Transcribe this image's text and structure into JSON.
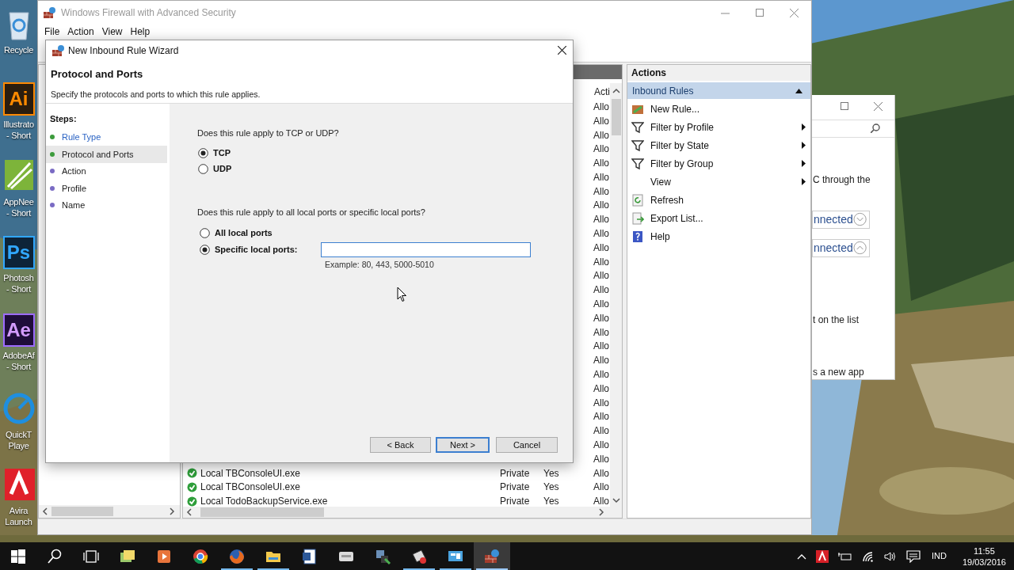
{
  "desktop_icons": [
    {
      "label": "Recycle",
      "kind": "recycle"
    },
    {
      "label": "Illustrato\n- Short",
      "kind": "ai",
      "glyph": "Ai"
    },
    {
      "label": "AppNee\n- Short",
      "kind": "appnee"
    },
    {
      "label": "Photosh\n- Short",
      "kind": "ps",
      "glyph": "Ps"
    },
    {
      "label": "AdobeAf\n- Short",
      "kind": "ae",
      "glyph": "Ae"
    },
    {
      "label": "QuickT\nPlaye",
      "kind": "quicktime"
    },
    {
      "label": "Avira\nLaunch",
      "kind": "avira"
    }
  ],
  "back_window": {
    "items": [
      {
        "kind": "text",
        "text": "C through the"
      },
      {
        "kind": "section",
        "text": "nnected",
        "expanded": false
      },
      {
        "kind": "section",
        "text": "nnected",
        "expanded": true
      },
      {
        "kind": "text",
        "text": "t on the list"
      },
      {
        "kind": "text",
        "text": "s a new app"
      }
    ]
  },
  "main_window": {
    "title": "Windows Firewall with Advanced Security",
    "menu": [
      "File",
      "Action",
      "View",
      "Help"
    ],
    "rules_list": {
      "columns": [
        "Acti"
      ],
      "rows": [
        {
          "action": "Allo"
        },
        {
          "action": "Allo"
        },
        {
          "action": "Allo"
        },
        {
          "action": "Allo"
        },
        {
          "action": "Allo"
        },
        {
          "action": "Allo"
        },
        {
          "action": "Allo"
        },
        {
          "action": "Allo"
        },
        {
          "action": "Allo"
        },
        {
          "action": "Allo"
        },
        {
          "action": "Allo"
        },
        {
          "action": "Allo"
        },
        {
          "action": "Allo"
        },
        {
          "action": "Allo"
        },
        {
          "action": "Allo"
        },
        {
          "action": "Allo"
        },
        {
          "action": "Allo"
        },
        {
          "action": "Allo"
        },
        {
          "action": "Allo"
        },
        {
          "action": "Allo"
        },
        {
          "action": "Allo"
        },
        {
          "action": "Allo"
        },
        {
          "action": "Allo"
        },
        {
          "action": "Allo"
        },
        {
          "action": "Allo"
        },
        {
          "action": "Allo"
        },
        {
          "name": "Local TBConsoleUI.exe",
          "enabled": true,
          "profile": "Private",
          "enabled_text": "Yes",
          "action": "Allo"
        },
        {
          "name": "Local TBConsoleUI.exe",
          "enabled": true,
          "profile": "Private",
          "enabled_text": "Yes",
          "action": "Allo"
        },
        {
          "name": "Local TodoBackupService.exe",
          "enabled": true,
          "profile": "Private",
          "enabled_text": "Yes",
          "action": "Allo"
        }
      ]
    },
    "actions": {
      "title": "Actions",
      "section": {
        "label": "Inbound Rules",
        "expanded": true
      },
      "items": [
        {
          "label": "New Rule...",
          "submenu": false
        },
        {
          "label": "Filter by Profile",
          "submenu": true
        },
        {
          "label": "Filter by State",
          "submenu": true
        },
        {
          "label": "Filter by Group",
          "submenu": true
        },
        {
          "label": "View",
          "submenu": true
        },
        {
          "label": "Refresh",
          "submenu": false
        },
        {
          "label": "Export List...",
          "submenu": false
        },
        {
          "label": "Help",
          "submenu": false
        }
      ]
    }
  },
  "wizard": {
    "title": "New Inbound Rule Wizard",
    "heading": "Protocol and Ports",
    "subtitle": "Specify the protocols and ports to which this rule applies.",
    "steps_title": "Steps:",
    "steps": [
      {
        "label": "Rule Type",
        "kind": "link",
        "color": "#3c9b3c",
        "selected": false
      },
      {
        "label": "Protocol and Ports",
        "kind": "text",
        "color": "#3c9b3c",
        "selected": true
      },
      {
        "label": "Action",
        "kind": "text",
        "color": "#7a6bc4",
        "selected": false
      },
      {
        "label": "Profile",
        "kind": "text",
        "color": "#7a6bc4",
        "selected": false
      },
      {
        "label": "Name",
        "kind": "text",
        "color": "#7a6bc4",
        "selected": false
      }
    ],
    "protocol_question": "Does this rule apply to TCP or UDP?",
    "protocol_options": [
      {
        "label": "TCP",
        "selected": true
      },
      {
        "label": "UDP",
        "selected": false
      }
    ],
    "ports_question": "Does this rule apply to all local ports or specific local ports?",
    "port_options": [
      {
        "label": "All local ports",
        "selected": false
      },
      {
        "label": "Specific local ports:",
        "selected": true
      }
    ],
    "ports_example": "Example: 80, 443, 5000-5010",
    "buttons": [
      {
        "label": "< Back",
        "default": false
      },
      {
        "label": "Next >",
        "default": true
      },
      {
        "label": "Cancel",
        "default": false
      }
    ]
  },
  "taskbar": {
    "apps": [
      {
        "running": false,
        "active": false
      },
      {
        "running": false,
        "active": false
      },
      {
        "running": false,
        "active": false
      },
      {
        "running": true,
        "active": false
      },
      {
        "running": true,
        "active": false
      },
      {
        "running": false,
        "active": false
      },
      {
        "running": false,
        "active": false
      },
      {
        "running": false,
        "active": false
      },
      {
        "running": true,
        "active": false
      },
      {
        "running": true,
        "active": false
      },
      {
        "running": true,
        "active": true
      }
    ],
    "language": "IND",
    "time": "11:55",
    "date": "19/03/2016"
  }
}
